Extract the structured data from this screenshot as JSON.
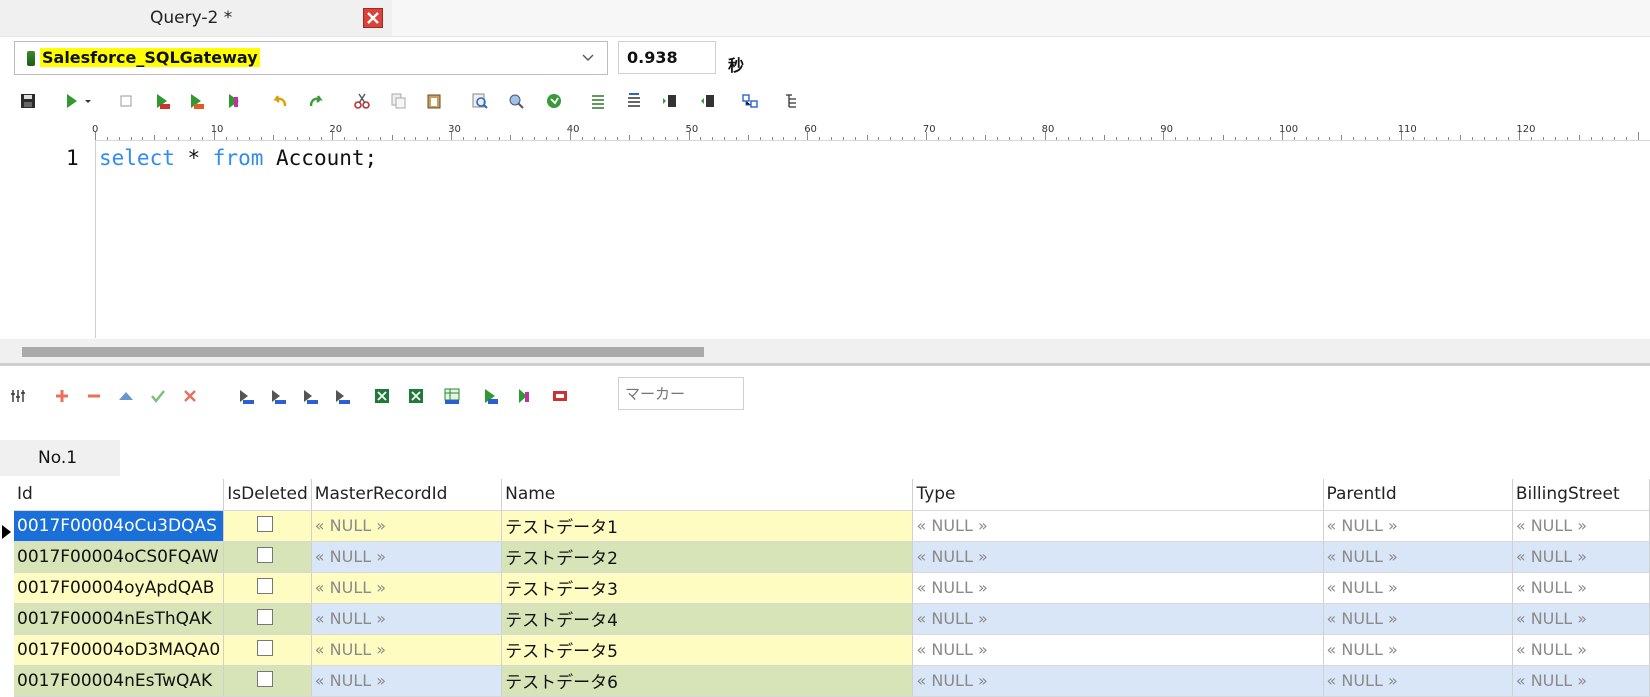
{
  "tab": {
    "title": "Query-2 *"
  },
  "connection": {
    "name": "Salesforce_SQLGateway"
  },
  "timing": {
    "value": "0.938",
    "unit": "秒"
  },
  "ruler": {
    "labels": [
      "0",
      "10",
      "20",
      "30",
      "40",
      "50",
      "60",
      "70",
      "80",
      "90",
      "100",
      "110",
      "120"
    ]
  },
  "editor": {
    "line_number": "1",
    "code": {
      "kw1": "select",
      "star": " * ",
      "kw2": "from",
      "rest": " Account;"
    }
  },
  "results": {
    "marker_placeholder": "マーカー",
    "tab_label": "No.1",
    "columns": [
      "Id",
      "IsDeleted",
      "MasterRecordId",
      "Name",
      "Type",
      "ParentId",
      "BillingStreet"
    ],
    "null_text": "« NULL »",
    "rows": [
      {
        "id": "0017F00004oCu3DQAS",
        "name": "テストデータ1"
      },
      {
        "id": "0017F00004oCS0FQAW",
        "name": "テストデータ2"
      },
      {
        "id": "0017F00004oyApdQAB",
        "name": "テストデータ3"
      },
      {
        "id": "0017F00004nEsThQAK",
        "name": "テストデータ4"
      },
      {
        "id": "0017F00004oD3MAQA0",
        "name": "テストデータ5"
      },
      {
        "id": "0017F00004nEsTwQAK",
        "name": "テストデータ6"
      }
    ]
  },
  "colors": {
    "keyword": "#2f8cf0",
    "row_green": "#d6e4b8",
    "row_blue": "#d9e6f7",
    "row_yellow": "#fefcc0",
    "selection": "#1b6fd8"
  }
}
